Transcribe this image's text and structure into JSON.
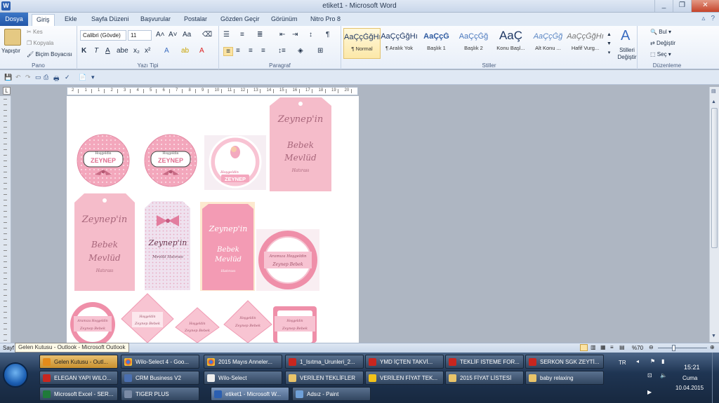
{
  "window": {
    "title": "etiket1 - Microsoft Word",
    "app_icon": "W",
    "buttons": [
      "_",
      "❐",
      "✕"
    ]
  },
  "tabs": [
    "Dosya",
    "Giriş",
    "Ekle",
    "Sayfa Düzeni",
    "Başvurular",
    "Postalar",
    "Gözden Geçir",
    "Görünüm",
    "Nitro Pro 8"
  ],
  "ribbon": {
    "clipboard": {
      "paste": "Yapıştır",
      "cut": "Kes",
      "copy": "Kopyala",
      "format_painter": "Biçim Boyacısı",
      "label": "Pano"
    },
    "font": {
      "name": "Calibri (Gövde)",
      "size": "11",
      "label": "Yazı Tipi"
    },
    "paragraph": {
      "label": "Paragraf"
    },
    "styles": {
      "label": "Stiller",
      "items": [
        {
          "sample": "AaÇçĞğHı",
          "name": "¶ Normal"
        },
        {
          "sample": "AaÇçĞğHı",
          "name": "¶ Aralık Yok"
        },
        {
          "sample": "AaÇçĞ",
          "name": "Başlık 1"
        },
        {
          "sample": "AaÇçĞğ",
          "name": "Başlık 2"
        },
        {
          "sample": "AaÇ",
          "name": "Konu Başl..."
        },
        {
          "sample": "AaÇçĞğ",
          "name": "Alt Konu ..."
        },
        {
          "sample": "AaÇçĞğHı",
          "name": "Hafif Vurg..."
        }
      ],
      "change_styles": "Stilleri Değiştir"
    },
    "editing": {
      "find": "Bul",
      "replace": "Değiştir",
      "select": "Seç",
      "label": "Düzenleme"
    }
  },
  "ruler": {
    "numbers": [
      "2",
      "1",
      "1",
      "2",
      "3",
      "4",
      "5",
      "6",
      "7",
      "8",
      "9",
      "10",
      "11",
      "12",
      "13",
      "14",
      "15",
      "16",
      "17",
      "18",
      "19",
      "20"
    ]
  },
  "labels": {
    "name": "ZEYNEP",
    "name_script": "Zeynep'in",
    "name_short": "Zeynep",
    "event": "Bebek Mevlüd",
    "memento": "Hatırası",
    "hosgeldin": "Hoşgeldin",
    "mevlut_hatirasi": "Mevlüt Hatırası",
    "aramiza": "Aramıza Hoşgeldin",
    "zeynep_bebek": "Zeynep Bebek"
  },
  "statusbar": {
    "left": "Sayf",
    "zoom": "%70",
    "tooltip": "Gelen Kutusu - Outlook - Microsoft Outlook"
  },
  "taskbar": {
    "row1": [
      "Gelen Kutusu - Outl...",
      "Wilo-Select 4 - Goo...",
      "2015 Mayıs Anneler...",
      "1_Isıtma_Urunleri_2...",
      "YMD İÇTEN TAKVİ...",
      "TEKLİF ISTEME FOR...",
      "SERKON SGK ZEYTİ..."
    ],
    "row2": [
      "ELEGAN YAPI WILO...",
      "CRM Business V2",
      "Wilo-Select",
      "VERİLEN TEKLİFLER",
      "VERİLEN FİYAT TEK...",
      "2015 FİYAT LİSTESİ",
      "baby relaxing"
    ],
    "row3": [
      "Microsoft Excel - SER...",
      "TIGER PLUS",
      "etiket1 - Microsoft W...",
      "Adsız - Paint"
    ],
    "tray": {
      "lang": "TR",
      "time": "15:21",
      "day": "Cuma",
      "date": "10.04.2015"
    }
  },
  "colors": {
    "pink": "#f4b6c8",
    "pink_dark": "#e07a98",
    "rose": "#f7cdd8",
    "lilac": "#efe0ee"
  }
}
